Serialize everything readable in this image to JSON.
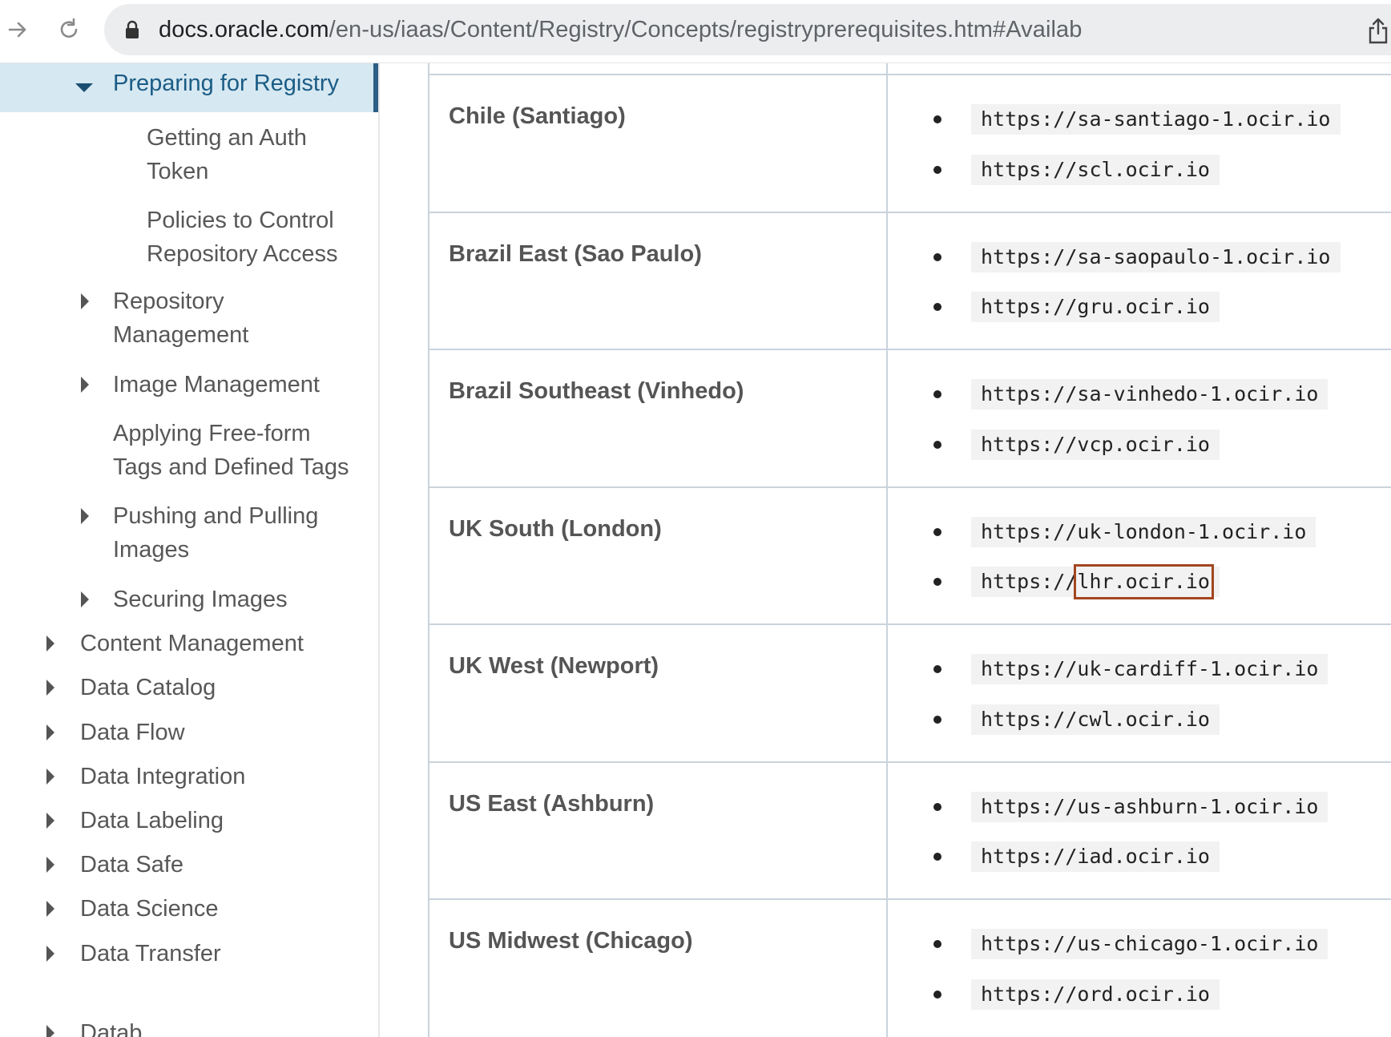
{
  "browser": {
    "url_host": "docs.oracle.com",
    "url_path": "/en-us/iaas/Content/Registry/Concepts/registryprerequisites.htm#Availab"
  },
  "sidebar": {
    "active": "Preparing for Registry",
    "sub_items": [
      {
        "line1": "Getting an Auth",
        "line2": "Token"
      },
      {
        "line1": "Policies to Control",
        "line2": "Repository Access"
      }
    ],
    "items": [
      {
        "line1": "Repository",
        "line2": "Management",
        "expandable": true
      },
      {
        "line1": "Image Management",
        "line2": "",
        "expandable": true
      },
      {
        "line1": "Applying Free-form",
        "line2": "Tags and Defined Tags",
        "expandable": false
      },
      {
        "line1": "Pushing and Pulling",
        "line2": "Images",
        "expandable": true
      },
      {
        "line1": "Securing Images",
        "line2": "",
        "expandable": true
      }
    ],
    "top_items": [
      "Content Management",
      "Data Catalog",
      "Data Flow",
      "Data Integration",
      "Data Labeling",
      "Data Safe",
      "Data Science",
      "Data Transfer",
      "Datab"
    ]
  },
  "table": {
    "rows": [
      {
        "region": "Chile (Santiago)",
        "urls": [
          "https://sa-santiago-1.ocir.io",
          "https://scl.ocir.io"
        ]
      },
      {
        "region": "Brazil East (Sao Paulo)",
        "urls": [
          "https://sa-saopaulo-1.ocir.io",
          "https://gru.ocir.io"
        ]
      },
      {
        "region": "Brazil Southeast (Vinhedo)",
        "urls": [
          "https://sa-vinhedo-1.ocir.io",
          "https://vcp.ocir.io"
        ]
      },
      {
        "region": "UK South (London)",
        "urls": [
          "https://uk-london-1.ocir.io",
          "https://lhr.ocir.io"
        ]
      },
      {
        "region": "UK West (Newport)",
        "urls": [
          "https://uk-cardiff-1.ocir.io",
          "https://cwl.ocir.io"
        ]
      },
      {
        "region": "US East (Ashburn)",
        "urls": [
          "https://us-ashburn-1.ocir.io",
          "https://iad.ocir.io"
        ]
      },
      {
        "region": "US Midwest (Chicago)",
        "urls": [
          "https://us-chicago-1.ocir.io",
          "https://ord.ocir.io"
        ]
      }
    ]
  },
  "colors": {
    "active_bg": "#d6e8f1",
    "active_text": "#1b5c86",
    "highlight": "#a3461f"
  }
}
